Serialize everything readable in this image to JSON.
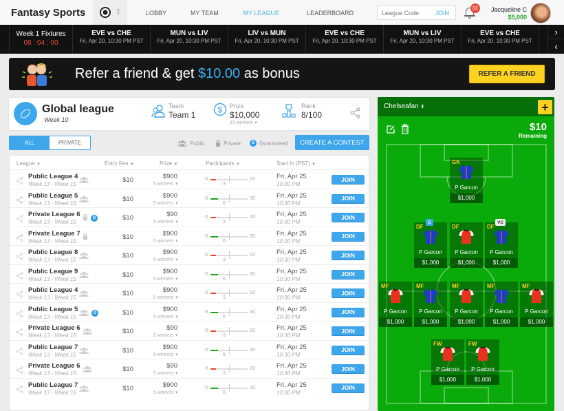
{
  "header": {
    "brand": "Fantasy Sports",
    "sport_icon": "soccer-ball-icon",
    "nav": [
      {
        "label": "LOBBY",
        "active": false
      },
      {
        "label": "MY TEAM",
        "active": false
      },
      {
        "label": "MY LEAGUE",
        "active": true
      },
      {
        "label": "LEADERBOARD",
        "active": false
      }
    ],
    "league_code_placeholder": "League Code",
    "league_code_join": "JOIN",
    "notification_count": "02",
    "user_name": "Jacqueline C",
    "user_balance": "$5,000"
  },
  "fixtures": {
    "week_label": "Week 1 Fixtures",
    "countdown": "08 : 04 : 00",
    "matches": [
      {
        "match": "EVE vs CHE",
        "date": "Fri, Apr 20, 10:30 PM PST"
      },
      {
        "match": "MUN vs LIV",
        "date": "Fri, Apr 20, 10:30 PM PST"
      },
      {
        "match": "LIV vs MUN",
        "date": "Fri, Apr 20, 10:30 PM PST"
      },
      {
        "match": "EVE vs CHE",
        "date": "Fri, Apr 20, 10:30 PM PST"
      },
      {
        "match": "MUN vs LIV",
        "date": "Fri, Apr 20, 10:30 PM PST"
      },
      {
        "match": "EVE vs CHE",
        "date": "Fri, Apr 20, 10:30 PM PST"
      }
    ],
    "next_icon": "chevron-right-icon",
    "prev_icon": "chevron-left-icon"
  },
  "refer": {
    "text_before": "Refer a friend & get ",
    "amount": "$10.00",
    "text_after": " as bonus",
    "button": "REFER A FRIEND",
    "amount_color": "#3ab0ee"
  },
  "league": {
    "title": "Global league",
    "week": "Week 10",
    "team_label": "Team",
    "team_value": "Team 1",
    "prize_label": "Prize",
    "prize_value": "$10,000",
    "prize_winners": "10 winners ▾",
    "rank_label": "Rank",
    "rank_value": "8/100"
  },
  "filters": {
    "tab_all": "ALL",
    "tab_private": "PRIVATE",
    "legend_public": "Public",
    "legend_private": "Private",
    "legend_guaranteed": "Guaranteed",
    "guaranteed_letter": "G",
    "create_button": "CREATE A CONTEST"
  },
  "table": {
    "columns": [
      "League",
      "Entry Fee",
      "Prize",
      "Participants",
      "Start In (PST)"
    ],
    "join_label": "JOIN",
    "rows": [
      {
        "name": "Public League 4",
        "weeks": "Week 13 - Week 15",
        "type": "public",
        "guaranteed": false,
        "fee": "$10",
        "prize": "$900",
        "winners": "5 winners ▾",
        "min": "0",
        "max": 20,
        "joined": 3,
        "date": "Fri, Apr 25",
        "time": "10:30 PM"
      },
      {
        "name": "Public League 5",
        "weeks": "Week 13 - Week 15",
        "type": "public",
        "guaranteed": false,
        "fee": "$10",
        "prize": "$900",
        "winners": "5 winners ▾",
        "min": "0",
        "max": 30,
        "joined": 6,
        "date": "Fri, Apr 25",
        "time": "10:30 PM"
      },
      {
        "name": "Private League 6",
        "weeks": "Week 13 - Week 15",
        "type": "private",
        "guaranteed": true,
        "fee": "$10",
        "prize": "$90",
        "winners": "5 winners ▾",
        "min": "0",
        "max": 20,
        "joined": 3,
        "date": "Fri, Apr 25",
        "time": "10:30 PM"
      },
      {
        "name": "Private League 7",
        "weeks": "Week 13 - Week 15",
        "type": "private",
        "guaranteed": false,
        "fee": "$10",
        "prize": "$900",
        "winners": "5 winners ▾",
        "min": "0",
        "max": 30,
        "joined": 6,
        "date": "Fri, Apr 25",
        "time": "10:30 PM"
      },
      {
        "name": "Public League 8",
        "weeks": "Week 13 - Week 15",
        "type": "public",
        "guaranteed": false,
        "fee": "$10",
        "prize": "$900",
        "winners": "5 winners ▾",
        "min": "0",
        "max": 20,
        "joined": 3,
        "date": "Fri, Apr 25",
        "time": "10:30 PM"
      },
      {
        "name": "Public League 9",
        "weeks": "Week 13 - Week 15",
        "type": "public",
        "guaranteed": false,
        "fee": "$10",
        "prize": "$900",
        "winners": "5 winners ▾",
        "min": "0",
        "max": 30,
        "joined": 6,
        "date": "Fri, Apr 25",
        "time": "10:30 PM"
      },
      {
        "name": "Public League 4",
        "weeks": "Week 13 - Week 15",
        "type": "public",
        "guaranteed": false,
        "fee": "$10",
        "prize": "$900",
        "winners": "5 winners ▾",
        "min": "0",
        "max": 20,
        "joined": 3,
        "date": "Fri, Apr 25",
        "time": "10:30 PM"
      },
      {
        "name": "Public League 5",
        "weeks": "Week 13 - Week 15",
        "type": "public",
        "guaranteed": true,
        "fee": "$10",
        "prize": "$900",
        "winners": "5 winners ▾",
        "min": "0",
        "max": 30,
        "joined": 6,
        "date": "Fri, Apr 25",
        "time": "10:30 PM"
      },
      {
        "name": "Private League 6",
        "weeks": "Week 13 - Week 15",
        "type": "public",
        "guaranteed": false,
        "fee": "$10",
        "prize": "$90",
        "winners": "5 winners ▾",
        "min": "0",
        "max": 20,
        "joined": 3,
        "date": "Fri, Apr 25",
        "time": "10:30 PM"
      },
      {
        "name": "Public League 7",
        "weeks": "Week 13 - Week 15",
        "type": "public",
        "guaranteed": false,
        "fee": "$10",
        "prize": "$900",
        "winners": "5 winners ▾",
        "min": "0",
        "max": 30,
        "joined": 6,
        "date": "Fri, Apr 25",
        "time": "10:30 PM"
      },
      {
        "name": "Private League 6",
        "weeks": "Week 13 - Week 15",
        "type": "public",
        "guaranteed": false,
        "fee": "$10",
        "prize": "$90",
        "winners": "5 winners ▾",
        "min": "0",
        "max": 20,
        "joined": 3,
        "date": "Fri, Apr 25",
        "time": "10:30 PM"
      },
      {
        "name": "Public League 7",
        "weeks": "Week 13 - Week 15",
        "type": "public",
        "guaranteed": false,
        "fee": "$10",
        "prize": "$900",
        "winners": "5 winners ▾",
        "min": "0",
        "max": 30,
        "joined": 6,
        "date": "Fri, Apr 25",
        "time": "10:30 PM"
      }
    ],
    "bar_colors": {
      "low": "#e8452c",
      "high": "#1fa51f"
    }
  },
  "team": {
    "name": "Chelseafan",
    "add_label": "+",
    "remaining_amount": "$10",
    "remaining_label": "Remaining",
    "colors": {
      "blue_shirt": "#1c3fbf",
      "red_shirt": "#e8321e"
    },
    "players": [
      {
        "pos": "GK",
        "name": "P Garcon",
        "price": "$1,000",
        "kit": "blue",
        "tag": ""
      },
      {
        "pos": "DF",
        "name": "P Garcon",
        "price": "$1,000",
        "kit": "blue",
        "tag": "C"
      },
      {
        "pos": "DF",
        "name": "P Garcon",
        "price": "$1,000",
        "kit": "red",
        "tag": ""
      },
      {
        "pos": "DF",
        "name": "P Garcon",
        "price": "$1,000",
        "kit": "blue",
        "tag": "VC"
      },
      {
        "pos": "MF",
        "name": "P Garcon",
        "price": "$1,000",
        "kit": "red",
        "tag": ""
      },
      {
        "pos": "MF",
        "name": "P Garcon",
        "price": "$1,000",
        "kit": "blue",
        "tag": ""
      },
      {
        "pos": "MF",
        "name": "P Garcon",
        "price": "$1,000",
        "kit": "red",
        "tag": ""
      },
      {
        "pos": "MF",
        "name": "P Garcon",
        "price": "$1,000",
        "kit": "blue",
        "tag": ""
      },
      {
        "pos": "MF",
        "name": "P Garcon",
        "price": "$1,000",
        "kit": "red",
        "tag": ""
      },
      {
        "pos": "FW",
        "name": "P Garcon",
        "price": "$1,000",
        "kit": "red",
        "tag": ""
      },
      {
        "pos": "FW",
        "name": "P Garcon",
        "price": "$1,000",
        "kit": "red",
        "tag": ""
      }
    ]
  }
}
